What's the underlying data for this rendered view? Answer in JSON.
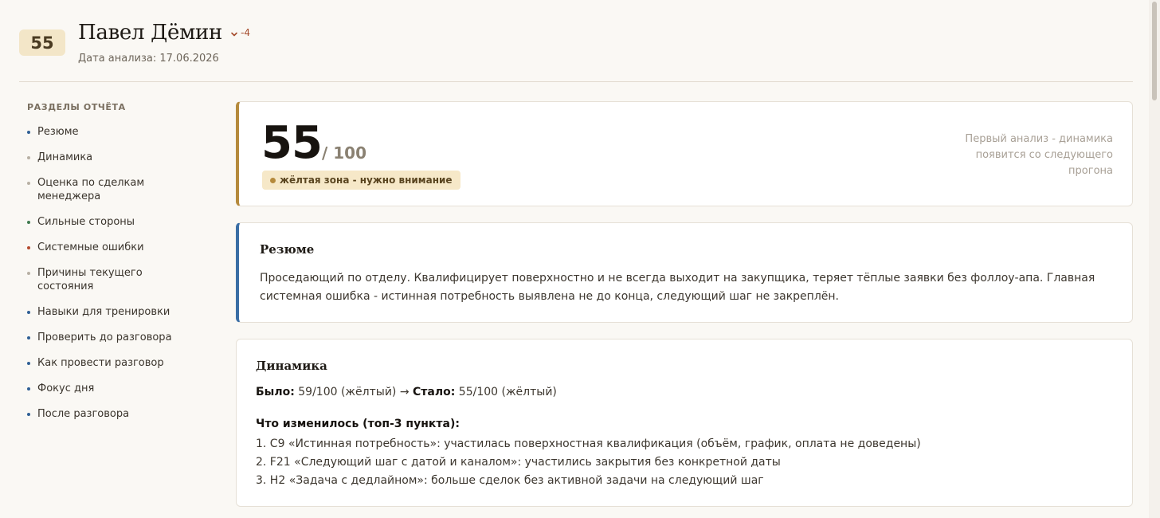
{
  "header": {
    "score": "55",
    "name": "Павел Дёмин",
    "delta": "-4",
    "date": "Дата анализа: 17.06.2026"
  },
  "sidebar": {
    "title": "РАЗДЕЛЫ ОТЧЁТА",
    "items": [
      {
        "label": "Резюме",
        "color": "#2f5f95"
      },
      {
        "label": "Динамика",
        "color": "#b8b0a4"
      },
      {
        "label": "Оценка по сделкам менеджера",
        "color": "#b8b0a4"
      },
      {
        "label": "Сильные стороны",
        "color": "#3f7a4f"
      },
      {
        "label": "Системные ошибки",
        "color": "#b44a2e"
      },
      {
        "label": "Причины текущего состояния",
        "color": "#b8b0a4"
      },
      {
        "label": "Навыки для тренировки",
        "color": "#2f5f95"
      },
      {
        "label": "Проверить до разговора",
        "color": "#2f5f95"
      },
      {
        "label": "Как провести разговор",
        "color": "#2f5f95"
      },
      {
        "label": "Фокус дня",
        "color": "#2f5f95"
      },
      {
        "label": "После разговора",
        "color": "#2f5f95"
      }
    ]
  },
  "score_card": {
    "score": "55",
    "out_of": "/ 100",
    "zone": "жёлтая зона - нужно внимание",
    "note": "Первый анализ - динамика появится со следующего прогона"
  },
  "resume": {
    "title": "Резюме",
    "text": "Проседающий по отделу. Квалифицирует поверхностно и не всегда выходит на закупщика, теряет тёплые заявки без фоллоу-апа. Главная системная ошибка - истинная потребность выявлена не до конца, следующий шаг не закреплён."
  },
  "dynamics": {
    "title": "Динамика",
    "was_label": "Было:",
    "was_value": "59/100 (жёлтый) →",
    "now_label": "Стало:",
    "now_value": "55/100 (жёлтый)",
    "changes_title": "Что изменилось (топ-3 пункта):",
    "changes": [
      "1. C9 «Истинная потребность»: участилась поверхностная квалификация (объём, график, оплата не доведены)",
      "2. F21 «Следующий шаг с датой и каналом»: участились закрытия без конкретной даты",
      "3. H2 «Задача с дедлайном»: больше сделок без активной задачи на следующий шаг"
    ]
  },
  "colors": {
    "accent_yellow": "#b58a3c",
    "accent_blue": "#3a6ea5"
  }
}
